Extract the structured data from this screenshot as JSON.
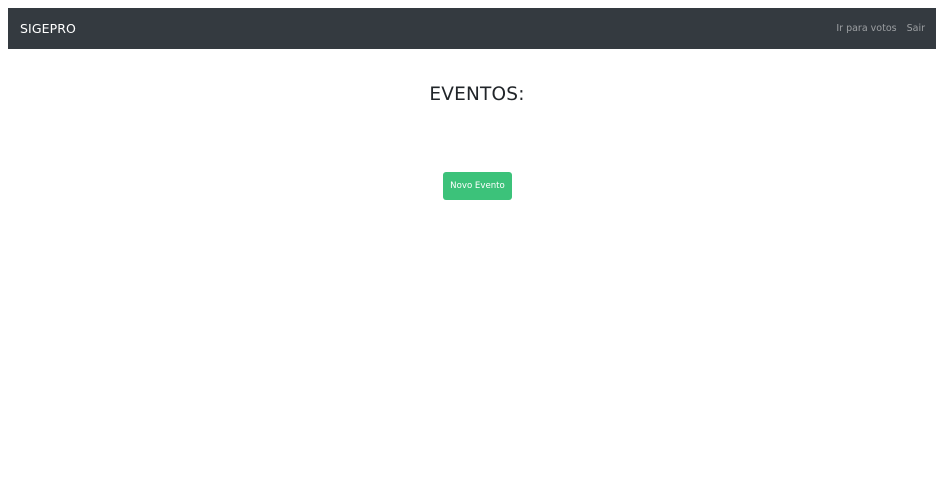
{
  "navbar": {
    "brand": "SIGEPRO",
    "links": [
      {
        "label": "Ir para votos"
      },
      {
        "label": "Sair"
      }
    ]
  },
  "main": {
    "title": "EVENTOS:",
    "new_event_button": "Novo Evento"
  },
  "colors": {
    "navbar_bg": "#343a40",
    "button_bg": "#3cc27a",
    "link_muted": "rgba(255,255,255,0.5)"
  }
}
